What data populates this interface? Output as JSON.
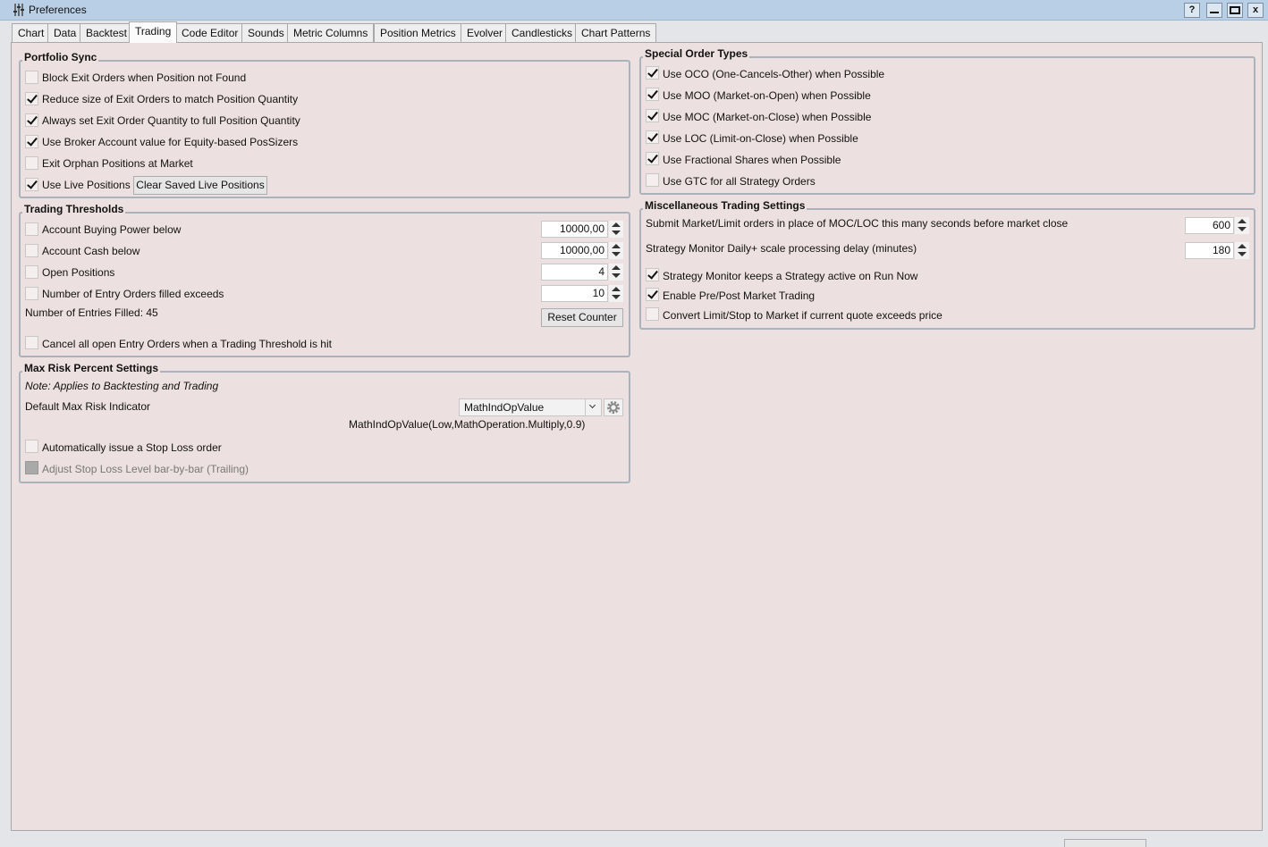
{
  "window": {
    "title": "Preferences",
    "help_label": "?",
    "close_label": "x",
    "app_icon": "sliders-icon"
  },
  "tabs": [
    "Chart",
    "Data",
    "Backtest",
    "Trading",
    "Code Editor",
    "Sounds",
    "Metric Columns",
    "Position Metrics",
    "Evolver",
    "Candlesticks",
    "Chart Patterns"
  ],
  "active_tab": "Trading",
  "portfolio_sync": {
    "title": "Portfolio Sync",
    "items": [
      {
        "label": "Block Exit Orders when Position not Found",
        "checked": false
      },
      {
        "label": "Reduce size of Exit Orders to match Position Quantity",
        "checked": true
      },
      {
        "label": "Always set Exit Order Quantity to full Position Quantity",
        "checked": true
      },
      {
        "label": "Use Broker Account value for Equity-based PosSizers",
        "checked": true
      },
      {
        "label": "Exit Orphan Positions at Market",
        "checked": false
      },
      {
        "label": "Use Live Positions",
        "checked": true
      }
    ],
    "clear_button": "Clear Saved Live Positions"
  },
  "trading_thresholds": {
    "title": "Trading Thresholds",
    "items": [
      {
        "label": "Account Buying Power below",
        "checked": false,
        "value": "10000,00"
      },
      {
        "label": "Account Cash below",
        "checked": false,
        "value": "10000,00"
      },
      {
        "label": "Open Positions",
        "checked": false,
        "value": "4"
      },
      {
        "label": "Number of Entry Orders filled exceeds",
        "checked": false,
        "value": "10"
      }
    ],
    "entries_filled": "Number of Entries Filled: 45",
    "reset_button": "Reset Counter",
    "cancel_label": "Cancel all open Entry Orders when a Trading Threshold is hit",
    "cancel_checked": false
  },
  "max_risk": {
    "title": "Max Risk Percent Settings",
    "note": "Note: Applies to Backtesting and Trading",
    "indicator_label": "Default Max Risk Indicator",
    "indicator_value": "MathIndOpValue",
    "indicator_expr": "MathIndOpValue(Low,MathOperation.Multiply,0.9)",
    "auto_stop_label": "Automatically issue a Stop Loss order",
    "auto_stop_checked": false,
    "trailing_label": "Adjust Stop Loss Level bar-by-bar (Trailing)",
    "trailing_disabled": true
  },
  "special_order_types": {
    "title": "Special Order Types",
    "items": [
      {
        "label": "Use OCO (One-Cancels-Other) when Possible",
        "checked": true
      },
      {
        "label": "Use MOO (Market-on-Open) when Possible",
        "checked": true
      },
      {
        "label": "Use MOC (Market-on-Close) when Possible",
        "checked": true
      },
      {
        "label": "Use LOC (Limit-on-Close) when Possible",
        "checked": true
      },
      {
        "label": "Use Fractional Shares when Possible",
        "checked": true
      },
      {
        "label": "Use GTC for all Strategy Orders",
        "checked": false
      }
    ]
  },
  "misc": {
    "title": "Miscellaneous Trading Settings",
    "submit_label": "Submit Market/Limit orders in place of MOC/LOC this many seconds before market close",
    "submit_value": "600",
    "delay_label": "Strategy Monitor Daily+ scale processing delay (minutes)",
    "delay_value": "180",
    "items": [
      {
        "label": "Strategy Monitor keeps a Strategy active on Run Now",
        "checked": true
      },
      {
        "label": "Enable Pre/Post Market Trading",
        "checked": true
      },
      {
        "label": "Convert Limit/Stop to Market if current quote exceeds price",
        "checked": false
      }
    ]
  }
}
